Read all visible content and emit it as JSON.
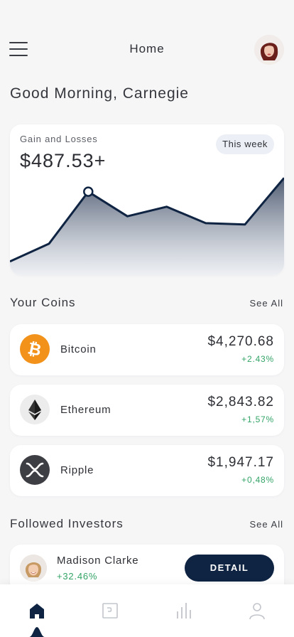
{
  "header": {
    "title": "Home"
  },
  "greeting": "Good Morning, Carnegie",
  "gains": {
    "label": "Gain and Losses",
    "value": "$487.53+",
    "period": "This week"
  },
  "chart_data": {
    "type": "area",
    "x": [
      0,
      1,
      2,
      3,
      4,
      5,
      6,
      7
    ],
    "values": [
      10,
      23,
      61,
      43,
      50,
      38,
      37,
      71
    ],
    "highlighted_point": 2,
    "ylim": [
      0,
      80
    ],
    "grid": false,
    "color": "#0f2442"
  },
  "coins": {
    "title": "Your Coins",
    "see_all": "See All",
    "items": [
      {
        "name": "Bitcoin",
        "price": "$4,270.68",
        "change": "+2.43%",
        "icon": "bitcoin-icon",
        "color": "#f2921a"
      },
      {
        "name": "Ethereum",
        "price": "$2,843.82",
        "change": "+1,57%",
        "icon": "ethereum-icon",
        "color": "#ececec"
      },
      {
        "name": "Ripple",
        "price": "$1,947.17",
        "change": "+0,48%",
        "icon": "ripple-icon",
        "color": "#3d3d44"
      }
    ]
  },
  "investors": {
    "title": "Followed Investors",
    "see_all": "See All",
    "items": [
      {
        "name": "Madison Clarke",
        "change": "+32.46%",
        "button": "DETAIL"
      }
    ]
  },
  "tabbar": {
    "items": [
      "home-icon",
      "wallet-icon",
      "stats-icon",
      "profile-icon"
    ],
    "active": 0
  },
  "colors": {
    "accent": "#0f2442",
    "positive": "#34a468",
    "background": "#f6f6f7"
  }
}
